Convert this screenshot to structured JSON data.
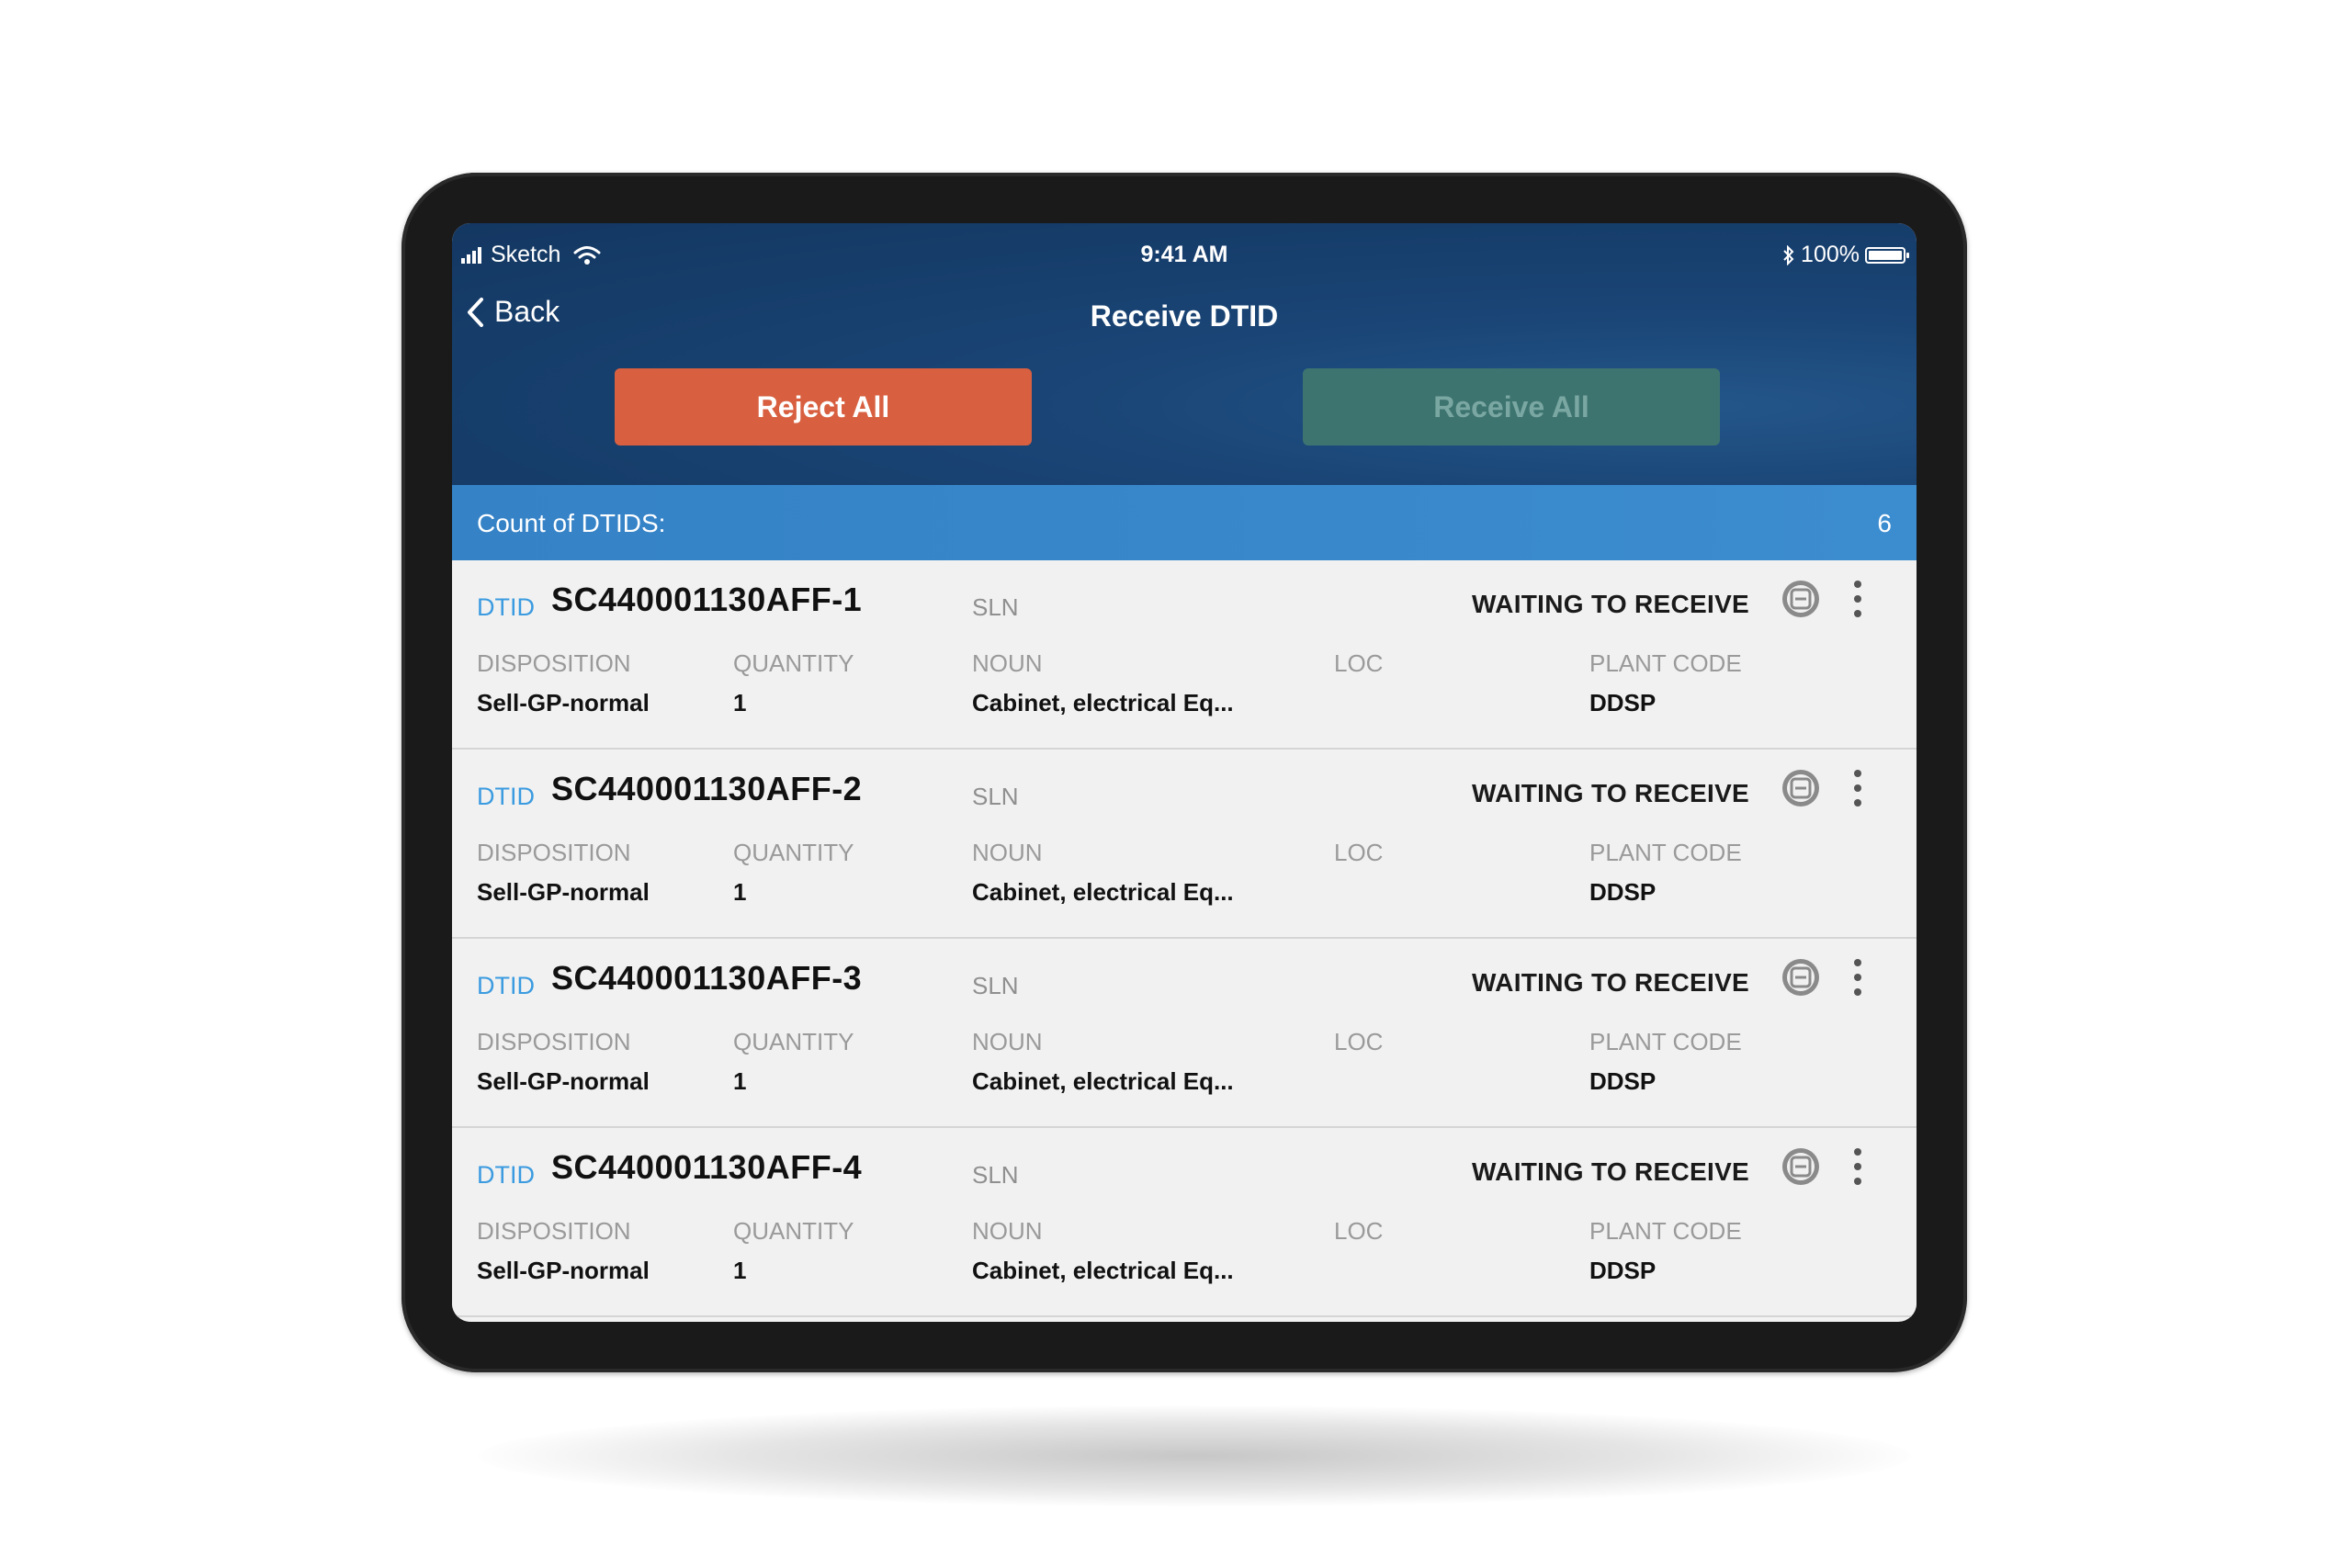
{
  "status_bar": {
    "carrier": "Sketch",
    "time": "9:41 AM",
    "battery": "100%"
  },
  "nav": {
    "back_label": "Back",
    "title": "Receive DTID"
  },
  "actions": {
    "reject_all": "Reject All",
    "receive_all": "Receive All"
  },
  "count": {
    "label": "Count of DTIDS:",
    "value": "6"
  },
  "labels": {
    "dtid": "DTID",
    "sln": "SLN",
    "disposition": "DISPOSITION",
    "quantity": "QUANTITY",
    "noun": "NOUN",
    "loc": "LOC",
    "plant_code": "PLANT CODE"
  },
  "items": [
    {
      "dtid": "SC440001130AFF-1",
      "status": "WAITING TO RECEIVE",
      "disposition": "Sell-GP-normal",
      "quantity": "1",
      "noun": "Cabinet, electrical Eq...",
      "loc": "",
      "plant_code": "DDSP"
    },
    {
      "dtid": "SC440001130AFF-2",
      "status": "WAITING TO RECEIVE",
      "disposition": "Sell-GP-normal",
      "quantity": "1",
      "noun": "Cabinet, electrical Eq...",
      "loc": "",
      "plant_code": "DDSP"
    },
    {
      "dtid": "SC440001130AFF-3",
      "status": "WAITING TO RECEIVE",
      "disposition": "Sell-GP-normal",
      "quantity": "1",
      "noun": "Cabinet, electrical Eq...",
      "loc": "",
      "plant_code": "DDSP"
    },
    {
      "dtid": "SC440001130AFF-4",
      "status": "WAITING TO RECEIVE",
      "disposition": "Sell-GP-normal",
      "quantity": "1",
      "noun": "Cabinet, electrical Eq...",
      "loc": "",
      "plant_code": "DDSP"
    }
  ],
  "colors": {
    "header": "#133761",
    "reject": "#d86040",
    "receive_disabled": "#3e7470",
    "count_bar": "#3582c6",
    "dtid_label": "#3b9be0"
  }
}
